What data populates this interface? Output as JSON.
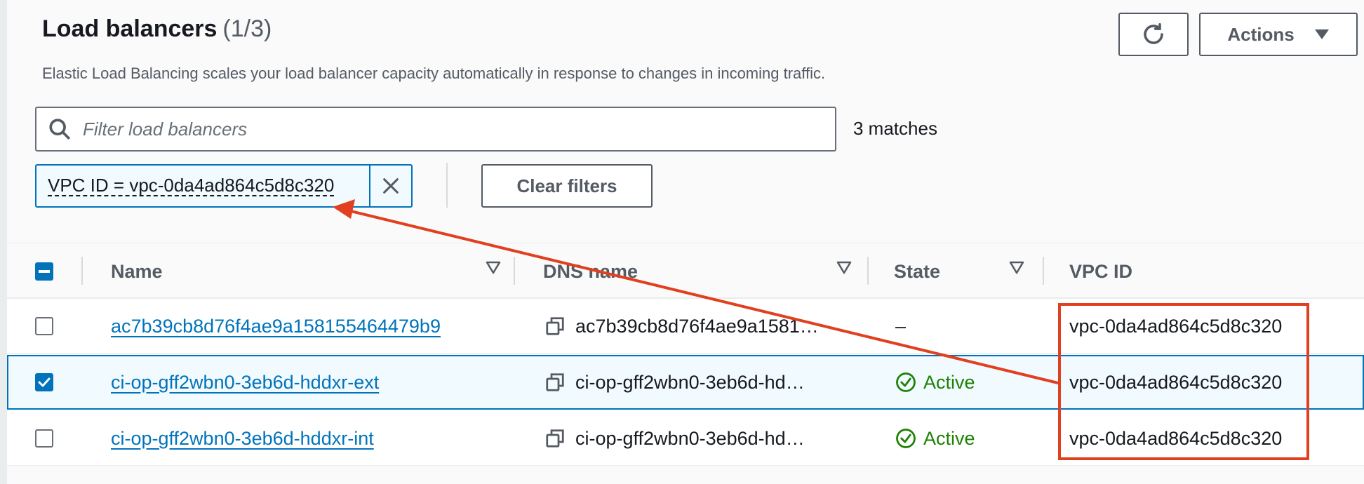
{
  "header": {
    "title": "Load balancers",
    "count": "(1/3)",
    "subtitle": "Elastic Load Balancing scales your load balancer capacity automatically in response to changes in incoming traffic.",
    "actions_label": "Actions"
  },
  "filter": {
    "placeholder": "Filter load balancers",
    "matches": "3 matches",
    "token_label": "VPC ID = vpc-0da4ad864c5d8c320",
    "clear_label": "Clear filters"
  },
  "table": {
    "columns": [
      "Name",
      "DNS name",
      "State",
      "VPC ID"
    ],
    "rows": [
      {
        "selected": false,
        "name": "ac7b39cb8d76f4ae9a158155464479b9",
        "dns": "ac7b39cb8d76f4ae9a1581…",
        "state": "–",
        "vpc": "vpc-0da4ad864c5d8c320"
      },
      {
        "selected": true,
        "name": "ci-op-gff2wbn0-3eb6d-hddxr-ext",
        "dns": "ci-op-gff2wbn0-3eb6d-hd…",
        "state": "Active",
        "vpc": "vpc-0da4ad864c5d8c320"
      },
      {
        "selected": false,
        "name": "ci-op-gff2wbn0-3eb6d-hddxr-int",
        "dns": "ci-op-gff2wbn0-3eb6d-hd…",
        "state": "Active",
        "vpc": "vpc-0da4ad864c5d8c320"
      }
    ]
  },
  "icons": {
    "refresh": "refresh-icon",
    "caret": "caret-down-icon",
    "search": "search-icon",
    "close": "close-icon",
    "sort": "sort-icon",
    "copy": "copy-icon",
    "status_ok": "check-circle-icon"
  },
  "colors": {
    "link": "#0073bb",
    "active": "#1d8102",
    "annotation": "#e0401f",
    "selected_bg": "#f1faff"
  }
}
